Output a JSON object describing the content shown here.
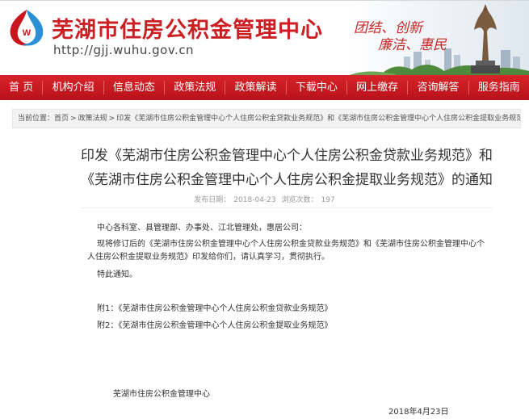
{
  "header": {
    "site_name": "芜湖市住房公积金管理中心",
    "site_url": "http://gjj.wuhu.gov.cn",
    "slogan_line1": "团结、创新",
    "slogan_line2": "廉洁、惠民"
  },
  "nav": {
    "items": [
      "首 页",
      "机构介绍",
      "信息动态",
      "政策法规",
      "政策解读",
      "下载中心",
      "网上缴存",
      "咨询解答",
      "服务指南"
    ]
  },
  "breadcrumb": {
    "prefix": "当前位置：",
    "items": [
      "首页",
      "政策法规",
      "印发《芜湖市住房公积金管理中心个人住房公积金贷款业务规范》和《芜湖市住房公积金管理中心个人住房公积金提取业务规范》的通知"
    ],
    "separator": ">"
  },
  "article": {
    "title": "印发《芜湖市住房公积金管理中心个人住房公积金贷款业务规范》和《芜湖市住房公积金管理中心个人住房公积金提取业务规范》的通知",
    "publish_label": "发布日期：",
    "publish_date": "2018-04-23",
    "views_label": "浏览次数：",
    "views": "197",
    "salutation": "中心各科室、县管理部、办事处、江北管理处，惠居公司：",
    "body_line1": "现将修订后的《芜湖市住房公积金管理中心个人住房公积金贷款业务规范》和《芜湖市住房公积金管理中心个",
    "body_line2": "人住房公积金提取业务规范》印发给你们，请认真学习，贯彻执行。",
    "closing": "特此通知。",
    "attachment1": "附1：《芜湖市住房公积金管理中心个人住房公积金贷款业务规范》",
    "attachment2": "附2：《芜湖市住房公积金管理中心个人住房公积金提取业务规范》",
    "issuer": "芜湖市住房公积金管理中心",
    "date": "2018年4月23日"
  },
  "colors": {
    "brand_red": "#c9161c",
    "title_red": "#cc1f24"
  }
}
